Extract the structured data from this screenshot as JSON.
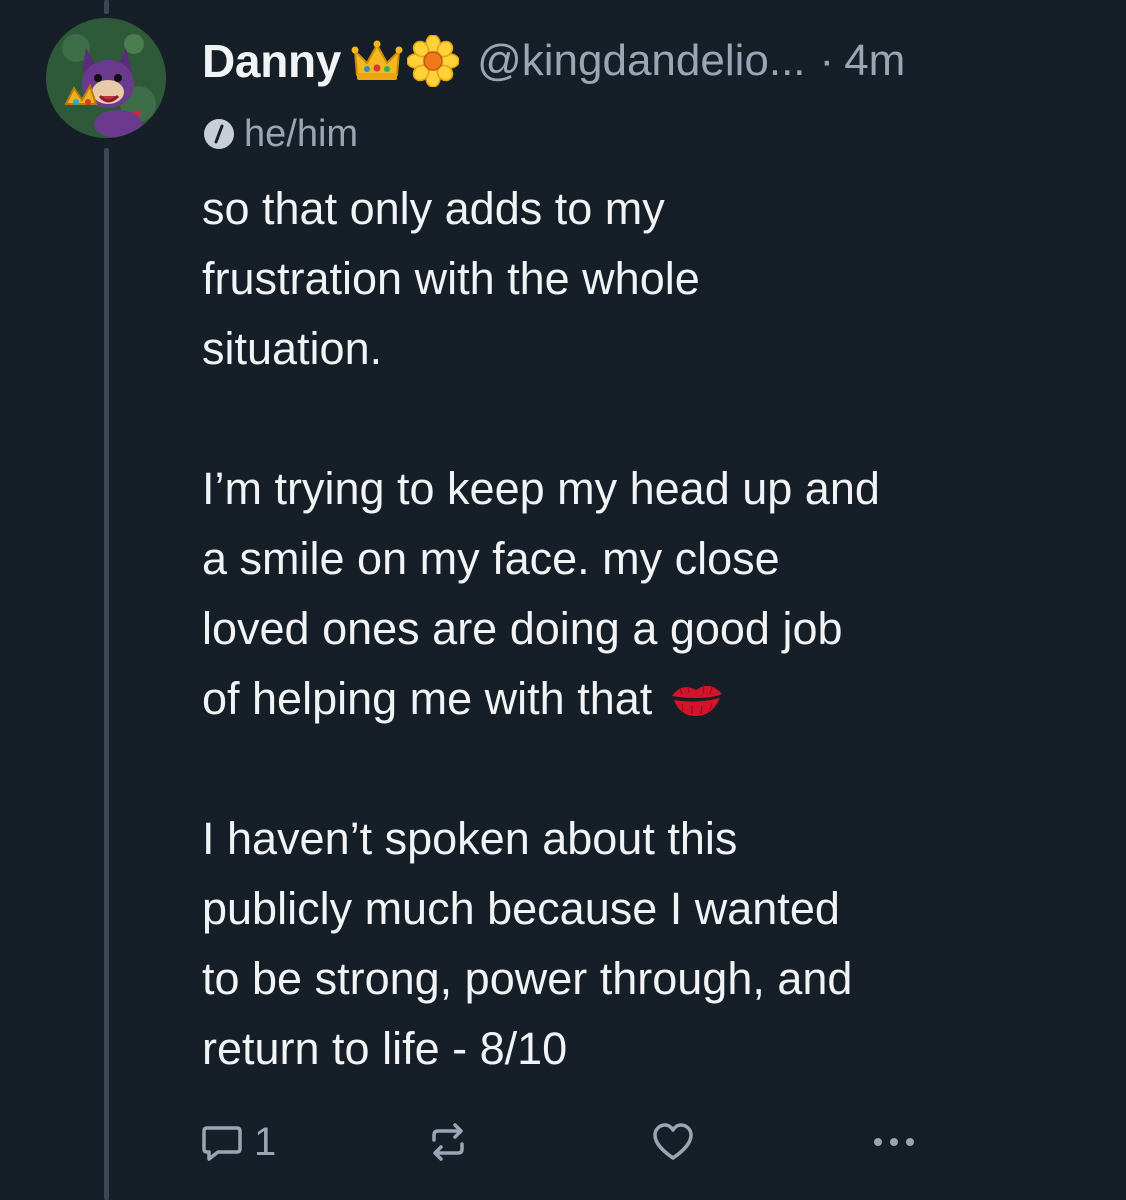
{
  "author": {
    "display_name": "Danny",
    "badges": [
      "crown-emoji",
      "blossom-emoji"
    ],
    "handle": "@kingdandelio...",
    "separator": "·",
    "timestamp": "4m",
    "pronouns": "he/him"
  },
  "post": {
    "paragraphs": [
      {
        "lines": [
          "so that only adds to my",
          "frustration with the whole",
          "situation."
        ]
      },
      {
        "lines": [
          "I’m trying to keep my head up and",
          "a smile on my face. my close",
          "loved ones are doing a good job",
          "of helping me with that"
        ]
      },
      {
        "lines": [
          "I haven’t spoken about this",
          "publicly much because I wanted",
          "to be strong, power through, and",
          "return to life - 8/10"
        ]
      }
    ],
    "trailing_emoji": "kiss-mark-emoji"
  },
  "actions": {
    "reply_count": "1",
    "icons": [
      "reply-icon",
      "repost-icon",
      "like-icon",
      "more-icon"
    ]
  },
  "colors": {
    "background": "#161e27",
    "text_primary": "#f1f3f5",
    "text_secondary": "#9aa6b4",
    "thread_line": "#3a4654"
  }
}
